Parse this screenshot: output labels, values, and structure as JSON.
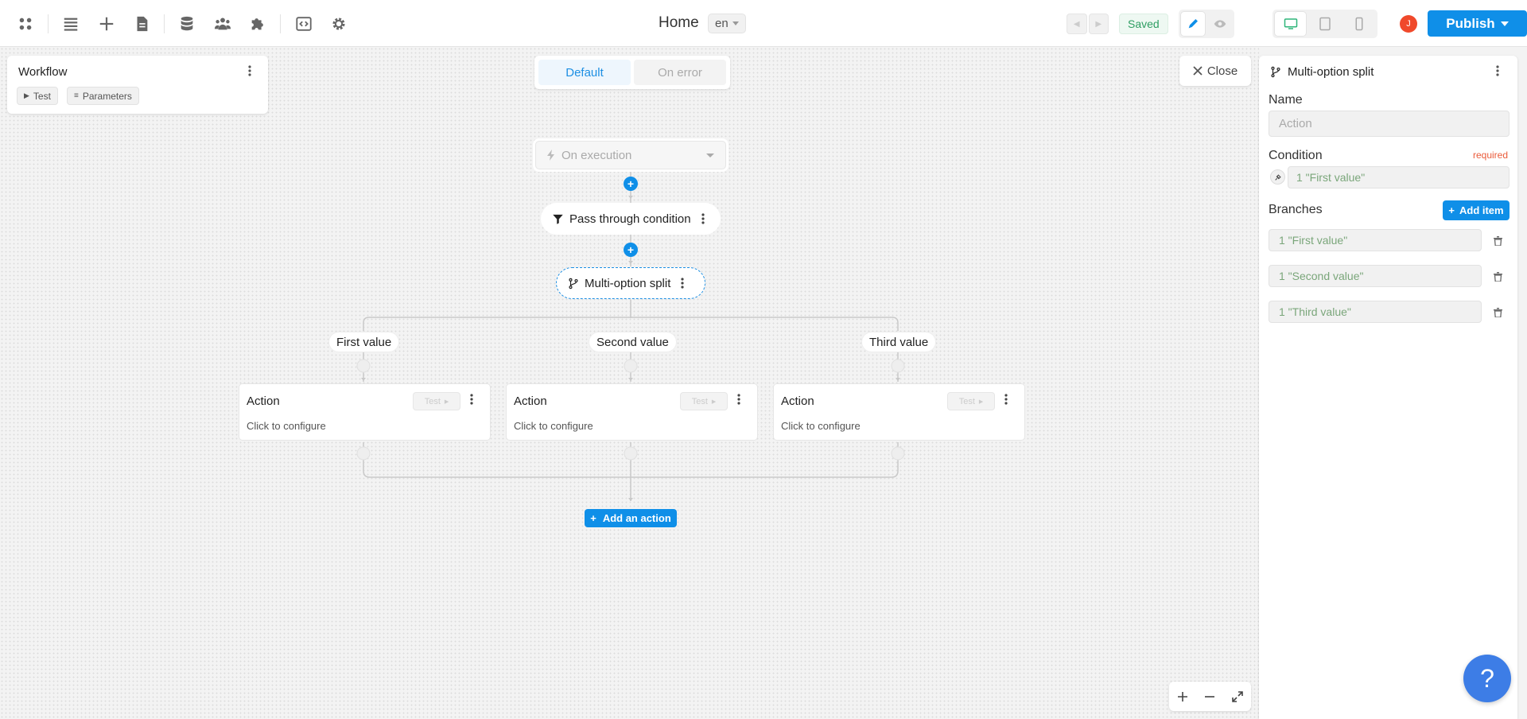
{
  "header": {
    "page_title": "Home",
    "language": "en",
    "saved_label": "Saved",
    "avatar_initial": "J",
    "publish_label": "Publish",
    "icons": [
      "apps-icon",
      "list-icon",
      "plus-icon",
      "file-icon",
      "database-icon",
      "users-icon",
      "puzzle-icon",
      "code-icon",
      "gear-icon"
    ]
  },
  "workflow": {
    "title": "Workflow",
    "test_label": "Test",
    "parameters_label": "Parameters"
  },
  "mode_toggle": {
    "default_label": "Default",
    "on_error_label": "On error"
  },
  "close_label": "Close",
  "flow": {
    "trigger_label": "On execution",
    "filter_label": "Pass through condition",
    "split_label": "Multi-option split",
    "branches": [
      "First value",
      "Second value",
      "Third value"
    ],
    "actions": [
      {
        "title": "Action",
        "subtitle": "Click to configure",
        "test": "Test"
      },
      {
        "title": "Action",
        "subtitle": "Click to configure",
        "test": "Test"
      },
      {
        "title": "Action",
        "subtitle": "Click to configure",
        "test": "Test"
      }
    ],
    "add_action_label": "Add an action"
  },
  "panel": {
    "title": "Multi-option split",
    "name_label": "Name",
    "name_placeholder": "Action",
    "condition_label": "Condition",
    "required_label": "required",
    "condition_value": "1 \"First value\"",
    "branches_label": "Branches",
    "add_item_label": "Add item",
    "branch_values": [
      "1 \"First value\"",
      "1 \"Second value\"",
      "1 \"Third value\""
    ]
  },
  "help_label": "?",
  "colors": {
    "accent": "#0f8fe8",
    "saved_green": "#2f9e63",
    "required": "#ea5b3a",
    "avatar": "#f0492b"
  }
}
